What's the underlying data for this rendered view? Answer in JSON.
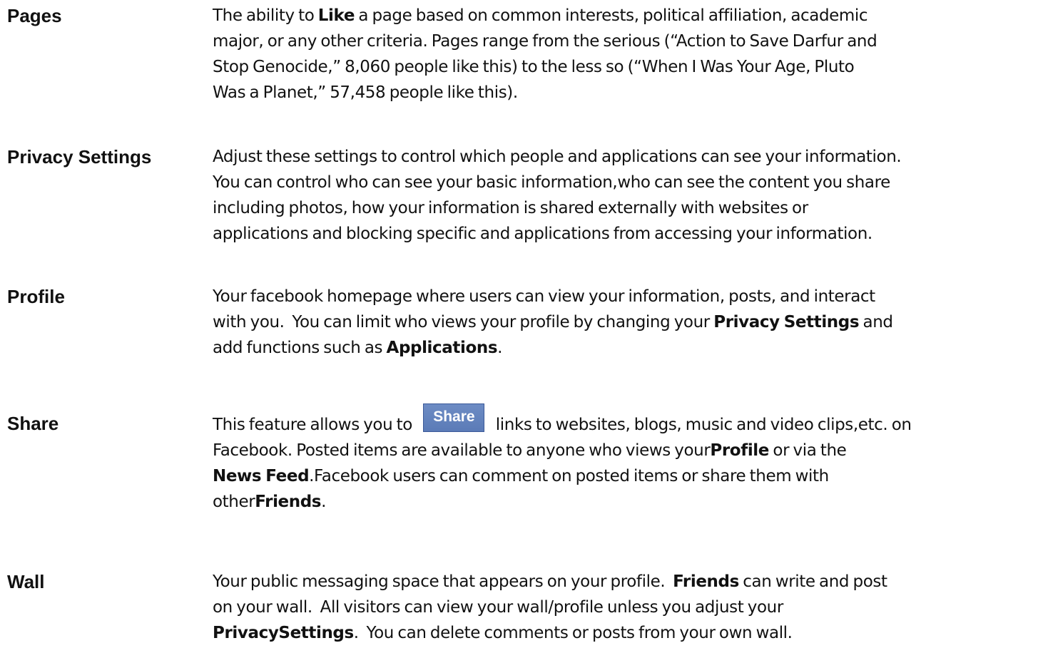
{
  "entries": [
    {
      "term": "Pages",
      "lines": [
        [
          "The ability to ",
          {
            "b": "Like"
          },
          " a page based on common interests, political affiliation, academic"
        ],
        [
          "major, or any other criteria. Pages range from the serious (“Action to Save Darfur and"
        ],
        [
          "Stop Genocide,” 8,060 people like this) to the less so (“When I Was Your Age, Pluto"
        ],
        [
          "Was a Planet,” 57,458 people like this)."
        ]
      ]
    },
    {
      "term": "Privacy Settings",
      "lines": [
        [
          "Adjust these settings to control which people and applications can see your information."
        ],
        [
          "You can control who can see your basic information,who can see the content you share"
        ],
        [
          "including photos, how your information is shared externally with websites or"
        ],
        [
          "applications and blocking specific and applications from accessing your information."
        ]
      ]
    },
    {
      "term": "Profile",
      "lines": [
        [
          "Your facebook homepage where users can view your information, posts, and interact"
        ],
        [
          "with you.  You can limit who views your profile by changing your ",
          {
            "b": "Privacy Settings"
          },
          " and"
        ],
        [
          "add functions such as ",
          {
            "b": "Applications"
          },
          "."
        ]
      ]
    },
    {
      "term": "Share",
      "lines": [
        [
          "This feature allows you to ",
          {
            "button": "Share"
          },
          " links to websites, blogs, music and video clips,etc. on"
        ],
        [
          "Facebook. Posted items are available to anyone who views your",
          {
            "b": "Profile"
          },
          " or via the"
        ],
        [
          {
            "b": "News Feed"
          },
          ".Facebook users can comment on posted items or share them with"
        ],
        [
          "other",
          {
            "b": "Friends"
          },
          "."
        ]
      ]
    },
    {
      "term": "Wall",
      "lines": [
        [
          "Your public messaging space that appears on your profile.  ",
          {
            "b": "Friends"
          },
          " can write and post"
        ],
        [
          "on your wall.  All visitors can view your wall/profile unless you adjust your"
        ],
        [
          {
            "b": "PrivacySettings"
          },
          ".  You can delete comments or posts from your own wall."
        ]
      ]
    }
  ],
  "colors": {
    "text": "#111111",
    "share_button_bg": "#5b7bb7",
    "share_button_border": "#3b5998",
    "share_button_text": "#ffffff"
  }
}
